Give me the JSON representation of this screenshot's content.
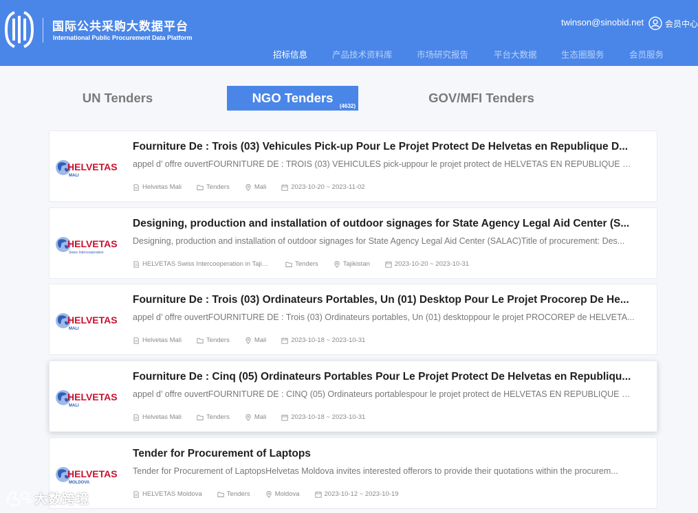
{
  "header": {
    "title_cn": "国际公共采购大数据平台",
    "title_en": "International Public Procurement Data Platform",
    "user_email": "twinson@sinobid.net",
    "member_center": "会员中心",
    "nav": [
      "招标信息",
      "产品技术资料库",
      "市场研究报告",
      "平台大数据",
      "生态圈服务",
      "会员服务"
    ],
    "nav_active": 0,
    "brand_color": "#4a86e8"
  },
  "tabs": {
    "un": "UN Tenders",
    "ngo": "NGO Tenders",
    "ngo_count": "(4632)",
    "gov": "GOV/MFI Tenders",
    "active": "ngo"
  },
  "tenders": [
    {
      "logo_brand": "HELVETAS",
      "logo_sub": "MALI",
      "title": "Fourniture De : Trois (03) Vehicules Pick-up Pour Le Projet Protect De Helvetas en Republique D...",
      "desc": "appel d’  offre ouvertFOURNITURE DE : TROIS (03) VEHICULES pick-uppour le projet protect de HELVETAS EN REPUBLIQUE DU ...",
      "org": "Helvetas Mali",
      "type": "Tenders",
      "country": "Mali",
      "dates": "2023-10-20 ~ 2023-11-02"
    },
    {
      "logo_brand": "HELVETAS",
      "logo_sub": "Swiss Intercooperation",
      "title": "Designing, production and installation of outdoor signages for State Agency Legal Aid Center (S...",
      "desc": "Designing, production and installation of outdoor signages for State Agency Legal Aid Center (SALAC)Title of procurement: Des...",
      "org": "HELVETAS Swiss Intercooperation in Tajiki...",
      "type": "Tenders",
      "country": "Tajikistan",
      "dates": "2023-10-20 ~ 2023-10-31"
    },
    {
      "logo_brand": "HELVETAS",
      "logo_sub": "MALI",
      "title": "Fourniture De : Trois (03) Ordinateurs Portables, Un (01) Desktop Pour Le Projet Procorep De He...",
      "desc": "appel d’  offre ouvertFOURNITURE DE : Trois (03) Ordinateurs portables, Un (01) desktoppour le projet PROCOREP de HELVETA...",
      "org": "Helvetas Mali",
      "type": "Tenders",
      "country": "Mali",
      "dates": "2023-10-18 ~ 2023-10-31"
    },
    {
      "logo_brand": "HELVETAS",
      "logo_sub": "MALI",
      "title": "Fourniture De : Cinq (05) Ordinateurs Portables Pour Le Projet Protect De Helvetas en Republiqu...",
      "desc": "appel d’  offre ouvertFOURNITURE DE : CINQ (05) Ordinateurs portablespour le projet protect de HELVETAS EN REPUBLIQUE D...",
      "org": "Helvetas Mali",
      "type": "Tenders",
      "country": "Mali",
      "dates": "2023-10-18 ~ 2023-10-31"
    },
    {
      "logo_brand": "HELVETAS",
      "logo_sub": "MOLDOVA",
      "title": "Tender for Procurement of Laptops",
      "desc": "Tender for Procurement of LaptopsHelvetas Moldova invites interested offerors to provide their quotations within the procurem...",
      "org": "HELVETAS Moldova",
      "type": "Tenders",
      "country": "Moldova",
      "dates": "2023-10-12 ~ 2023-10-19"
    }
  ],
  "watermark": "大数跨境",
  "colors": {
    "helvetas_red": "#c8102e",
    "globe_blue": "#4a86e8"
  }
}
